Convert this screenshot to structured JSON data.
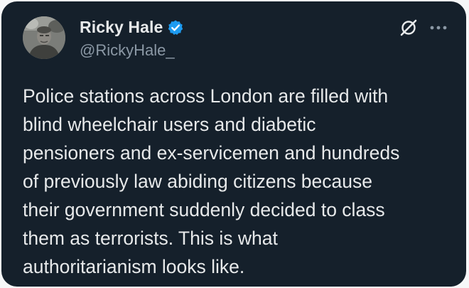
{
  "author": {
    "display_name": "Ricky Hale",
    "handle": "@RickyHale_",
    "verified": true,
    "avatar_icon": "profile-photo"
  },
  "tweet": {
    "text": "Police stations across London are filled with\nblind wheelchair users and diabetic\npensioners and ex-servicemen and hundreds\nof previously law abiding citizens because\ntheir government suddenly decided to class\nthem as terrorists. This is what\nauthoritarianism looks like."
  },
  "icons": {
    "verified": "verified-badge-icon",
    "logo": "x-logo-icon",
    "more": "more-options-icon"
  },
  "colors": {
    "background": "#15202b",
    "text": "#e7e9ea",
    "secondary_text": "#8b98a5",
    "verified_blue": "#1d9bf0"
  }
}
